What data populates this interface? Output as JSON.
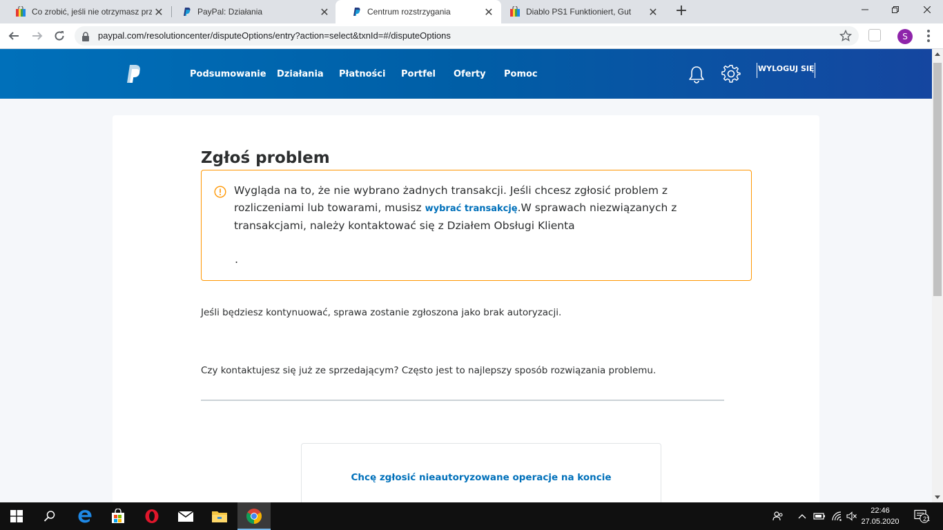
{
  "browser": {
    "tabs": [
      {
        "title": "Co zrobić, jeśli nie otrzymasz prz",
        "icon": "shopping-bag-icon"
      },
      {
        "title": "PayPal: Działania",
        "icon": "paypal-icon"
      },
      {
        "title": "Centrum rozstrzygania",
        "icon": "paypal-icon",
        "active": true
      },
      {
        "title": "Diablo PS1 Funktioniert, Gut",
        "icon": "shopping-bag-icon"
      }
    ],
    "tab_close": "✕",
    "new_tab": "+",
    "url": "paypal.com/resolutioncenter/disputeOptions/entry?action=select&txnId=#/disputeOptions",
    "profile_initial": "S"
  },
  "paypal": {
    "nav": [
      "Podsumowanie",
      "Działania",
      "Płatności",
      "Portfel",
      "Oferty",
      "Pomoc"
    ],
    "logout": "WYLOGUJ SIĘ"
  },
  "content": {
    "heading": "Zgłoś problem",
    "alert": {
      "text_before": "Wygląda na to, że nie wybrano żadnych transakcji. Jeśli chcesz zgłosić problem z rozliczeniami lub towarami, musisz ",
      "link": "wybrać transakcję",
      "text_after": ".W sprawach niezwiązanych z transakcjami, należy kontaktować się z Działem Obsługi Klienta",
      "trailing": "."
    },
    "paragraph1": "Jeśli będziesz kontynuować, sprawa zostanie zgłoszona jako brak autoryzacji.",
    "paragraph2": "Czy kontaktujesz się już ze sprzedającym? Często jest to najlepszy sposób rozwiązania problemu.",
    "option": "Chcę zgłosić nieautoryzowane operacje na koncie"
  },
  "taskbar": {
    "time": "22:46",
    "date": "27.05.2020",
    "notifications": "21"
  },
  "colors": {
    "paypal_blue": "#0070ba",
    "alert_border": "#ff9600",
    "header_gradient_end": "#1546a0"
  }
}
